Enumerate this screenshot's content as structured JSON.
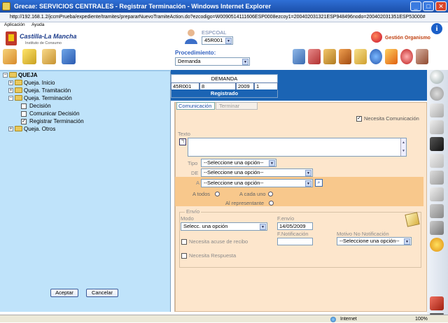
{
  "window": {
    "title": "Grecae: SERVICIOS CENTRALES - Registrar Terminación - Windows Internet Explorer",
    "address": "http://192.168.1.2/jccmPrueba/expediente/tramites/prepararNuevoTramiteAction.do?ezcodigo=W0090514111606ESP0008ezcoy1=200402031321ESP948496nodo=200402031351ESP53000#"
  },
  "menubar": {
    "items": [
      "Aplicación",
      "Ayuda"
    ]
  },
  "header": {
    "logo_name": "Castilla-La Mancha",
    "logo_sub": "Instituto de Consumo",
    "espcoal_label": "ESPCOAL",
    "espcoal_value": "45R001",
    "gestion_label": "Gestión Organismo",
    "procedimiento_label": "Procedimiento:",
    "procedimiento_value": "Demanda"
  },
  "tree": {
    "root": "QUEJA",
    "items": [
      {
        "label": "Queja. Inicio"
      },
      {
        "label": "Queja. Tramitación"
      },
      {
        "label": "Queja. Terminación"
      },
      {
        "label": "Decisión"
      },
      {
        "label": "Comunicar Decisión"
      },
      {
        "label": "Registrar Terminación"
      },
      {
        "label": "Queja. Otros"
      }
    ]
  },
  "panel_buttons": {
    "accept": "Aceptar",
    "cancel": "Cancelar"
  },
  "record": {
    "title": "DEMANDA",
    "cells": [
      "45R001",
      "8",
      "2009",
      "1"
    ],
    "status": "Registrado"
  },
  "tabs": {
    "comunicacion": "Comunicación",
    "terminar": "Terminar"
  },
  "form": {
    "necesita_comunicacion": "Necesita Comunicación",
    "texto_label": "Texto",
    "tipo_label": "Tipo",
    "tipo_value": "--Seleccione una opción--",
    "de_label": "DE",
    "de_value": "--Seleccione una opción--",
    "a_label": "A",
    "a_value": "--Seleccione una opción--",
    "a_todos": "A todos",
    "a_cada_uno": "A cada uno",
    "al_representante": "Al representante",
    "envio_label": "Envío",
    "modo_label": "Modo",
    "modo_value": "Selecc. una opción",
    "fenvio_label": "F.envío",
    "fenvio_value": "14/05/2009",
    "fnotificacion_label": "F.Notificación",
    "motivo_label": "Motivo No Notificación",
    "motivo_value": "--Seleccione una opción--",
    "acuse_label": "Necesita acuse de recibo",
    "respuesta_label": "Necesita Respuesta"
  },
  "statusbar": {
    "zone": "Internet",
    "zoom": "100%"
  }
}
